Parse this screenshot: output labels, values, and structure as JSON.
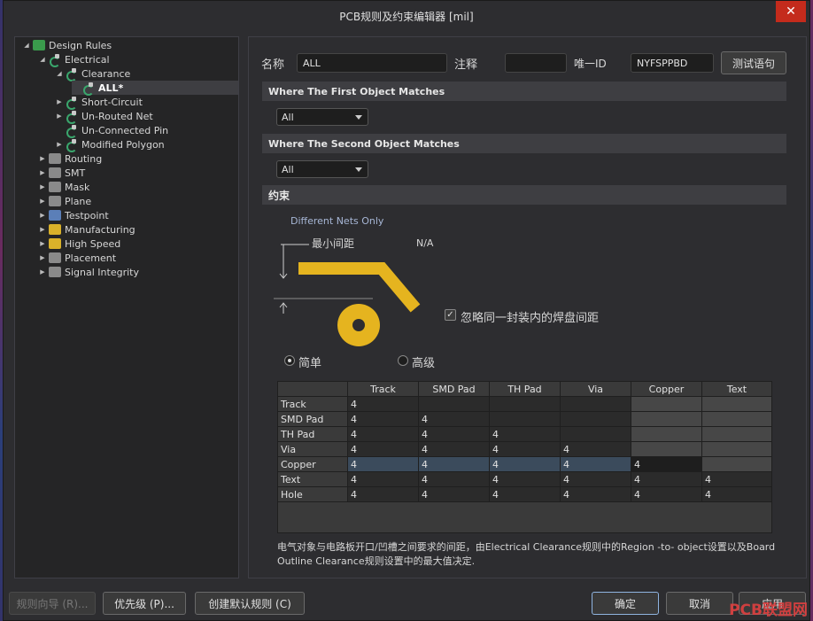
{
  "window": {
    "title": "PCB规则及约束编辑器 [mil]",
    "close_glyph": "✕"
  },
  "tree": {
    "root": "Design Rules",
    "electrical": "Electrical",
    "clearance": "Clearance",
    "all": "ALL*",
    "short_circuit": "Short-Circuit",
    "un_routed_net": "Un-Routed Net",
    "un_connected_pin": "Un-Connected Pin",
    "modified_polygon": "Modified Polygon",
    "routing": "Routing",
    "smt": "SMT",
    "mask": "Mask",
    "plane": "Plane",
    "testpoint": "Testpoint",
    "manufacturing": "Manufacturing",
    "high_speed": "High Speed",
    "placement": "Placement",
    "signal_integrity": "Signal Integrity"
  },
  "header": {
    "name_label": "名称",
    "name_value": "ALL",
    "comment_label": "注释",
    "comment_value": "",
    "uid_label": "唯一ID",
    "uid_value": "NYFSPPBD",
    "test_button": "测试语句"
  },
  "first_match": {
    "title": "Where The First Object Matches",
    "value": "All"
  },
  "second_match": {
    "title": "Where The Second Object Matches",
    "value": "All"
  },
  "constraints": {
    "title": "约束",
    "net_scope": "Different Nets Only",
    "min_clearance": "最小间距",
    "na": "N/A",
    "ignore_pads": "忽略同一封装内的焊盘间距",
    "check_glyph": "✓",
    "mode_simple": "简单",
    "mode_advanced": "高级"
  },
  "grid": {
    "columns": [
      "Track",
      "SMD Pad",
      "TH Pad",
      "Via",
      "Copper",
      "Text"
    ],
    "rows": [
      {
        "label": "Track",
        "values": [
          "4",
          "",
          "",
          "",
          "",
          ""
        ]
      },
      {
        "label": "SMD Pad",
        "values": [
          "4",
          "4",
          "",
          "",
          "",
          ""
        ]
      },
      {
        "label": "TH Pad",
        "values": [
          "4",
          "4",
          "4",
          "",
          "",
          ""
        ]
      },
      {
        "label": "Via",
        "values": [
          "4",
          "4",
          "4",
          "4",
          "",
          ""
        ]
      },
      {
        "label": "Copper",
        "values": [
          "4",
          "4",
          "4",
          "4",
          "4",
          ""
        ]
      },
      {
        "label": "Text",
        "values": [
          "4",
          "4",
          "4",
          "4",
          "4",
          "4"
        ]
      },
      {
        "label": "Hole",
        "values": [
          "4",
          "4",
          "4",
          "4",
          "4",
          "4"
        ]
      }
    ]
  },
  "description": "电气对象与电路板开口/凹槽之间要求的间距，由Electrical Clearance规则中的Region -to- object设置以及Board Outline Clearance规则设置中的最大值决定.",
  "footer": {
    "rule_wizard": "规则向导 (R)...",
    "priorities": "优先级 (P)...",
    "create_default": "创建默认规则 (C)",
    "ok": "确定",
    "cancel": "取消",
    "apply": "应用"
  },
  "watermark": "PCB联盟网",
  "colors": {
    "copper": "#e5b41f",
    "accent": "#c42b1c"
  }
}
